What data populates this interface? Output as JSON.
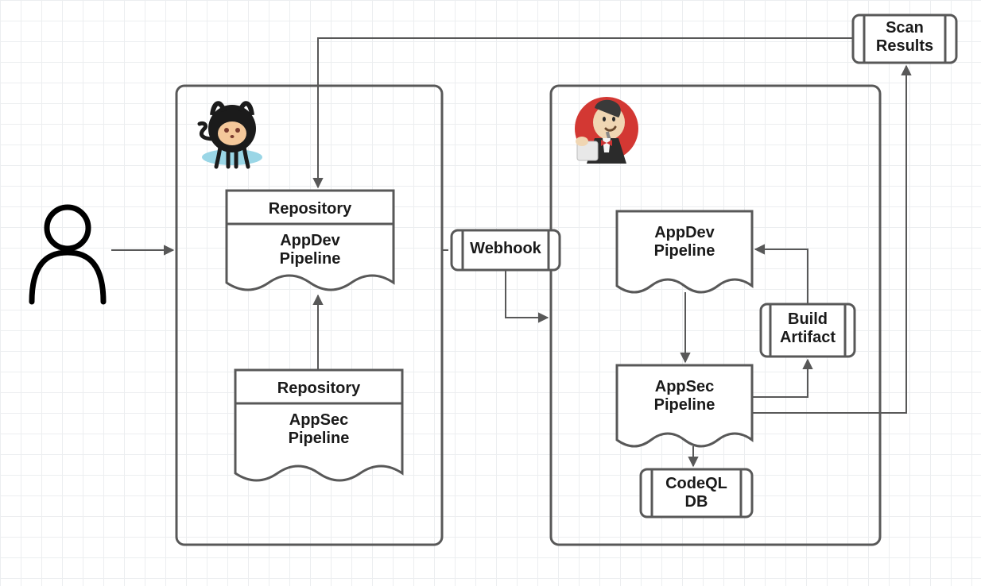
{
  "nodes": {
    "scan_results": "Scan\nResults",
    "repo_appdev_title": "Repository",
    "repo_appdev_sub": "AppDev\nPipeline",
    "repo_appsec_title": "Repository",
    "repo_appsec_sub": "AppSec\nPipeline",
    "webhook": "Webhook",
    "appdev_pipeline": "AppDev\nPipeline",
    "appsec_pipeline": "AppSec\nPipeline",
    "build_artifact": "Build\nArtifact",
    "codeql_db": "CodeQL\nDB"
  },
  "icons": {
    "github": "github-logo",
    "jenkins": "jenkins-logo",
    "user": "user-icon"
  },
  "colors": {
    "stroke": "#585858",
    "fill": "#ffffff"
  }
}
